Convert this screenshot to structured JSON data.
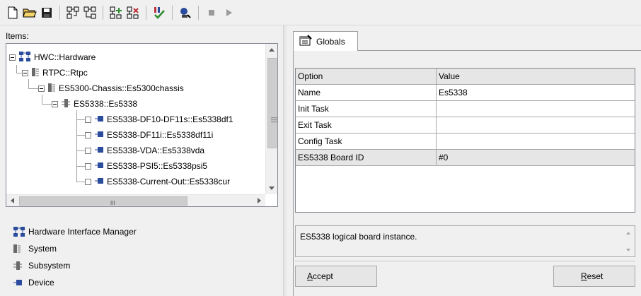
{
  "toolbar": {
    "buttons": [
      "new-file",
      "open-folder",
      "save",
      "add-item",
      "remove-item",
      "add-child",
      "remove-child",
      "check",
      "run",
      "stop",
      "play"
    ]
  },
  "left": {
    "items_label": "Items:",
    "tree": [
      {
        "label": "HWC::Hardware",
        "icon": "hardware-icon"
      },
      {
        "label": "RTPC::Rtpc",
        "icon": "system-icon"
      },
      {
        "label": "ES5300-Chassis::Es5300chassis",
        "icon": "system-icon"
      },
      {
        "label": "ES5338::Es5338",
        "icon": "subsystem-icon"
      },
      {
        "label": "ES5338-DF10-DF11s::Es5338df1",
        "icon": "device-icon"
      },
      {
        "label": "ES5338-DF11i::Es5338df11i",
        "icon": "device-icon"
      },
      {
        "label": "ES5338-VDA::Es5338vda",
        "icon": "device-icon"
      },
      {
        "label": "ES5338-PSI5::Es5338psi5",
        "icon": "device-icon"
      },
      {
        "label": "ES5338-Current-Out::Es5338cur",
        "icon": "device-icon"
      }
    ],
    "hscroll_grip": "III",
    "legend": [
      {
        "label": "Hardware Interface Manager"
      },
      {
        "label": "System"
      },
      {
        "label": "Subsystem"
      },
      {
        "label": "Device"
      }
    ]
  },
  "right": {
    "tab_label": "Globals",
    "grid": {
      "headers": [
        "Option",
        "Value"
      ],
      "rows": [
        [
          "Name",
          "Es5338"
        ],
        [
          "Init Task",
          ""
        ],
        [
          "Exit Task",
          ""
        ],
        [
          "Config Task",
          ""
        ],
        [
          "ES5338 Board ID",
          "#0"
        ]
      ]
    },
    "description": "ES5338 logical board instance.",
    "accept_prefix": "A",
    "accept_rest": "ccept",
    "reset_prefix": "R",
    "reset_rest": "eset"
  },
  "colors": {
    "icon_blue": "#2b4c9c",
    "icon_gray": "#6a6a6a",
    "green": "#2e8b2e",
    "red": "#c0303b"
  }
}
